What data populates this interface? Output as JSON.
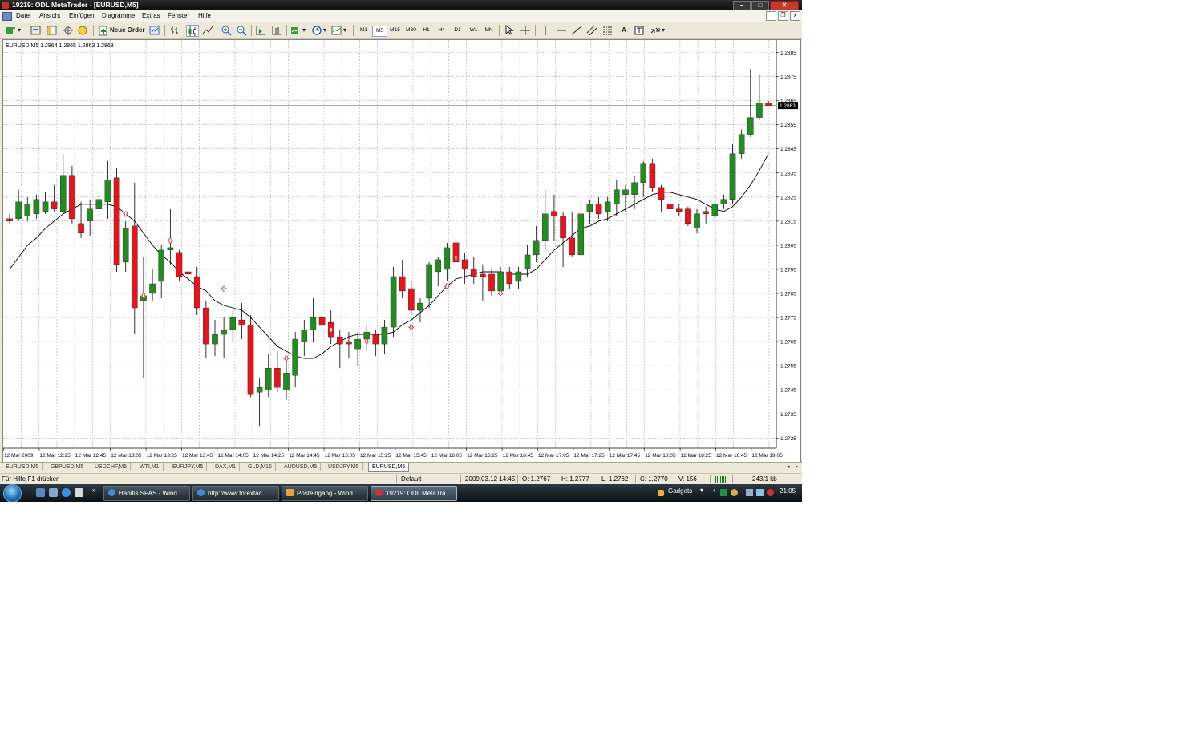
{
  "window": {
    "title": "19219: ODL MetaTrader - [EURUSD,M5]",
    "buttons": {
      "minimize": "–",
      "maximize": "□",
      "close": "✕"
    },
    "mdi_buttons": {
      "minimize": "_",
      "restore": "❐",
      "close": "x"
    }
  },
  "menu": [
    "Datei",
    "Ansicht",
    "Einfügen",
    "Diagramme",
    "Extras",
    "Fenster",
    "Hilfe"
  ],
  "toolbar": {
    "new_order_label": "Neue Order",
    "timeframes": [
      "M1",
      "M5",
      "M15",
      "M30",
      "H1",
      "H4",
      "D1",
      "W1",
      "MN"
    ],
    "active_timeframe": "M5",
    "text_tool": "A"
  },
  "chart_header": "EURUSD,M5  1.2864 1.2865 1.2863 1.2863",
  "chart_data": {
    "type": "candlestick",
    "symbol": "EURUSD,M5",
    "ylim": [
      1.2719,
      1.2893
    ],
    "y_ticks": [
      "1.2885",
      "1.2875",
      "1.2865",
      "1.2855",
      "1.2845",
      "1.2835",
      "1.2825",
      "1.2815",
      "1.2805",
      "1.2795",
      "1.2785",
      "1.2775",
      "1.2765",
      "1.2755",
      "1.2745",
      "1.2735",
      "1.2725"
    ],
    "current_price_label": "1.2863",
    "current_price": 1.2863,
    "x_ticks": [
      "12 Mar 2009",
      "12 Mar 12:25",
      "12 Mar 12:45",
      "12 Mar 13:05",
      "12 Mar 13:25",
      "12 Mar 13:45",
      "12 Mar 14:05",
      "12 Mar 14:25",
      "12 Mar 14:45",
      "12 Mar 15:05",
      "12 Mar 15:25",
      "12 Mar 15:45",
      "12 Mar 16:05",
      "12 Mar 16:25",
      "12 Mar 16:45",
      "12 Mar 17:05",
      "12 Mar 17:25",
      "12 Mar 17:45",
      "12 Mar 18:05",
      "12 Mar 18:25",
      "12 Mar 18:45",
      "12 Mar 19:05"
    ],
    "candles": [
      [
        1.2816,
        1.2818,
        1.2814,
        1.2815
      ],
      [
        1.2816,
        1.2828,
        1.2815,
        1.2823
      ],
      [
        1.2817,
        1.2825,
        1.2815,
        1.2822
      ],
      [
        1.2818,
        1.2826,
        1.2816,
        1.2824
      ],
      [
        1.2819,
        1.2827,
        1.2818,
        1.2823
      ],
      [
        1.2823,
        1.283,
        1.2819,
        1.282
      ],
      [
        1.2819,
        1.2843,
        1.2818,
        1.2834
      ],
      [
        1.2834,
        1.2838,
        1.2814,
        1.2816
      ],
      [
        1.2814,
        1.2823,
        1.2808,
        1.281
      ],
      [
        1.2815,
        1.2824,
        1.2809,
        1.282
      ],
      [
        1.282,
        1.2827,
        1.2817,
        1.2824
      ],
      [
        1.2823,
        1.284,
        1.2816,
        1.2832
      ],
      [
        1.2833,
        1.2837,
        1.2794,
        1.2797
      ],
      [
        1.2798,
        1.2815,
        1.2794,
        1.2812
      ],
      [
        1.2813,
        1.2831,
        1.2768,
        1.2779
      ],
      [
        1.2782,
        1.28,
        1.275,
        1.2784
      ],
      [
        1.2785,
        1.2795,
        1.2782,
        1.2789
      ],
      [
        1.279,
        1.2805,
        1.2783,
        1.2803
      ],
      [
        1.2803,
        1.282,
        1.2797,
        1.2804
      ],
      [
        1.2802,
        1.2803,
        1.279,
        1.2792
      ],
      [
        1.2794,
        1.2801,
        1.2781,
        1.2793
      ],
      [
        1.2792,
        1.2796,
        1.2776,
        1.2779
      ],
      [
        1.2779,
        1.2782,
        1.2758,
        1.2764
      ],
      [
        1.2764,
        1.2774,
        1.2759,
        1.2768
      ],
      [
        1.2768,
        1.2775,
        1.2758,
        1.277
      ],
      [
        1.277,
        1.2778,
        1.2765,
        1.2775
      ],
      [
        1.2774,
        1.2781,
        1.2766,
        1.2772
      ],
      [
        1.2772,
        1.2776,
        1.2742,
        1.2743
      ],
      [
        1.2744,
        1.275,
        1.273,
        1.2746
      ],
      [
        1.2745,
        1.276,
        1.2742,
        1.2754
      ],
      [
        1.2754,
        1.2761,
        1.2744,
        1.2746
      ],
      [
        1.2745,
        1.2758,
        1.2741,
        1.2752
      ],
      [
        1.2751,
        1.2769,
        1.2746,
        1.2766
      ],
      [
        1.2765,
        1.2774,
        1.2759,
        1.277
      ],
      [
        1.277,
        1.2783,
        1.2765,
        1.2775
      ],
      [
        1.2775,
        1.2783,
        1.2769,
        1.2772
      ],
      [
        1.2773,
        1.2778,
        1.2764,
        1.2767
      ],
      [
        1.2767,
        1.277,
        1.2754,
        1.2764
      ],
      [
        1.2765,
        1.2769,
        1.2758,
        1.2764
      ],
      [
        1.2762,
        1.2769,
        1.2755,
        1.2766
      ],
      [
        1.2766,
        1.2772,
        1.2761,
        1.2769
      ],
      [
        1.2768,
        1.277,
        1.2759,
        1.2764
      ],
      [
        1.2764,
        1.2774,
        1.276,
        1.2771
      ],
      [
        1.2771,
        1.2796,
        1.2767,
        1.2792
      ],
      [
        1.2792,
        1.2799,
        1.2783,
        1.2786
      ],
      [
        1.2787,
        1.279,
        1.2776,
        1.2778
      ],
      [
        1.2778,
        1.2783,
        1.2773,
        1.2781
      ],
      [
        1.2783,
        1.2798,
        1.2779,
        1.2797
      ],
      [
        1.2794,
        1.28,
        1.2788,
        1.2799
      ],
      [
        1.2795,
        1.2806,
        1.279,
        1.2804
      ],
      [
        1.2806,
        1.2809,
        1.2795,
        1.2798
      ],
      [
        1.2799,
        1.2802,
        1.2789,
        1.2795
      ],
      [
        1.2795,
        1.28,
        1.2789,
        1.2792
      ],
      [
        1.2793,
        1.2797,
        1.2782,
        1.2792
      ],
      [
        1.2793,
        1.2795,
        1.2784,
        1.2786
      ],
      [
        1.2786,
        1.2796,
        1.2784,
        1.2794
      ],
      [
        1.2794,
        1.2796,
        1.2787,
        1.2789
      ],
      [
        1.279,
        1.2796,
        1.2787,
        1.2794
      ],
      [
        1.2795,
        1.2805,
        1.2792,
        1.2801
      ],
      [
        1.2801,
        1.2813,
        1.2798,
        1.2807
      ],
      [
        1.2807,
        1.2828,
        1.2803,
        1.2818
      ],
      [
        1.2819,
        1.2826,
        1.2807,
        1.2817
      ],
      [
        1.2817,
        1.2819,
        1.2796,
        1.2808
      ],
      [
        1.2808,
        1.2819,
        1.28,
        1.2801
      ],
      [
        1.2801,
        1.2823,
        1.28,
        1.2818
      ],
      [
        1.2819,
        1.2824,
        1.2814,
        1.2822
      ],
      [
        1.2822,
        1.2825,
        1.2816,
        1.2818
      ],
      [
        1.2819,
        1.2825,
        1.2815,
        1.2823
      ],
      [
        1.2822,
        1.2832,
        1.2817,
        1.2828
      ],
      [
        1.2826,
        1.283,
        1.2819,
        1.2828
      ],
      [
        1.2826,
        1.2834,
        1.282,
        1.2831
      ],
      [
        1.2831,
        1.284,
        1.2825,
        1.2839
      ],
      [
        1.2839,
        1.2841,
        1.2827,
        1.2829
      ],
      [
        1.2829,
        1.283,
        1.2819,
        1.2824
      ],
      [
        1.2822,
        1.2823,
        1.2817,
        1.282
      ],
      [
        1.282,
        1.2822,
        1.2817,
        1.2819
      ],
      [
        1.282,
        1.2821,
        1.2813,
        1.2814
      ],
      [
        1.2812,
        1.282,
        1.281,
        1.2818
      ],
      [
        1.2819,
        1.2821,
        1.2814,
        1.2818
      ],
      [
        1.2817,
        1.2823,
        1.2815,
        1.2822
      ],
      [
        1.2822,
        1.2826,
        1.282,
        1.2824
      ],
      [
        1.2824,
        1.2847,
        1.2822,
        1.2843
      ],
      [
        1.2843,
        1.2853,
        1.2841,
        1.2851
      ],
      [
        1.2851,
        1.2878,
        1.285,
        1.2858
      ],
      [
        1.2858,
        1.2876,
        1.2857,
        1.2864
      ],
      [
        1.2864,
        1.2865,
        1.2863,
        1.2863
      ]
    ],
    "moving_average": [
      1.2795,
      1.28,
      1.2805,
      1.2808,
      1.2812,
      1.2815,
      1.2818,
      1.282,
      1.2822,
      1.2822,
      1.2822,
      1.2822,
      1.2821,
      1.2818,
      1.2815,
      1.281,
      1.2805,
      1.2801,
      1.2798,
      1.2794,
      1.2791,
      1.2788,
      1.2786,
      1.2782,
      1.278,
      1.2779,
      1.2778,
      1.2775,
      1.2771,
      1.2767,
      1.2763,
      1.2761,
      1.2759,
      1.2758,
      1.2758,
      1.276,
      1.2763,
      1.2765,
      1.2767,
      1.2768,
      1.2768,
      1.2768,
      1.2768,
      1.2769,
      1.2772,
      1.2774,
      1.2777,
      1.278,
      1.2784,
      1.2788,
      1.2791,
      1.2792,
      1.2793,
      1.2794,
      1.2794,
      1.2794,
      1.2793,
      1.2793,
      1.2793,
      1.2795,
      1.2799,
      1.2803,
      1.2806,
      1.2809,
      1.2812,
      1.2813,
      1.2815,
      1.2816,
      1.2818,
      1.282,
      1.2822,
      1.2824,
      1.2826,
      1.2827,
      1.2827,
      1.2826,
      1.2825,
      1.2824,
      1.2822,
      1.282,
      1.2819,
      1.2821,
      1.2825,
      1.283,
      1.2836,
      1.2843
    ],
    "fractals_up": [
      [
        13,
        1.2818
      ],
      [
        18,
        1.2807
      ],
      [
        24,
        1.2787
      ],
      [
        36,
        1.277
      ],
      [
        50,
        1.28
      ]
    ],
    "fractals_down": [
      [
        15,
        1.2784
      ],
      [
        31,
        1.2758
      ],
      [
        40,
        1.2765
      ],
      [
        45,
        1.2771
      ],
      [
        49,
        1.2788
      ],
      [
        55,
        1.2785
      ]
    ],
    "colors": {
      "bull": "#228b22",
      "bear": "#e8141c",
      "grid": "#a8a8a8",
      "ma": "#000000",
      "fractal": "#d32f2f"
    }
  },
  "symbol_tabs": [
    "EURUSD,M5",
    "GBPUSD,M5",
    "USDCHF,M5",
    "WTI,M1",
    "EURJPY,M5",
    "DAX,M1",
    "GLD,M15",
    "AUDUSD,M5",
    "USDJPY,M5",
    "EURUSD,M5"
  ],
  "active_symbol_tab": 9,
  "tab_scroll": {
    "left": "◂",
    "right": "▸"
  },
  "status": {
    "help": "Für Hilfe F1 drücken",
    "profile": "Default",
    "datetime": "2009.03.12 14:45",
    "open": "O: 1.2767",
    "high": "H: 1.2777",
    "low": "L: 1.2762",
    "close": "C: 1.2770",
    "volume": "V: 156",
    "traffic": "243/1 kb"
  },
  "taskbar": {
    "more": "»",
    "tasks": [
      {
        "label": "Hanifis SPAS - Wind...",
        "color": "#3b8fe0"
      },
      {
        "label": "http://www.forexfac...",
        "color": "#3b8fe0"
      },
      {
        "label": "Posteingang - Wind...",
        "color": "#e0a43b"
      },
      {
        "label": "19219: ODL MetaTra...",
        "color": "#d03030"
      }
    ],
    "gadgets": "Gadgets",
    "clock": "21:05"
  }
}
